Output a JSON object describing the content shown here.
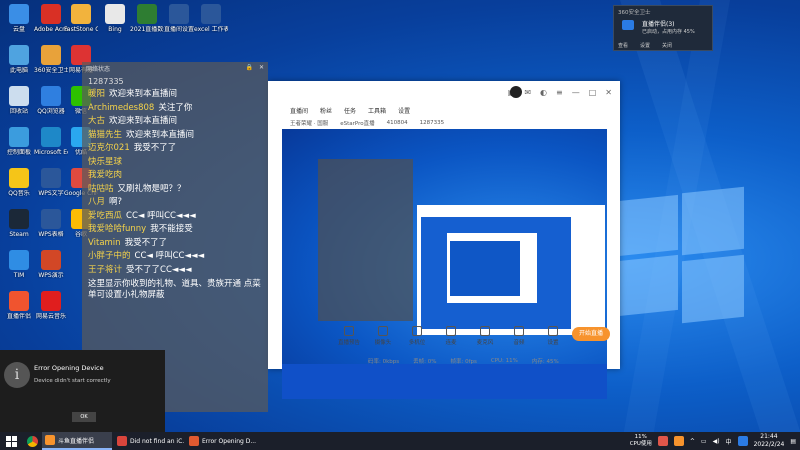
{
  "desktop": {
    "icons": [
      {
        "label": "云盘",
        "color": "#3a8ee6"
      },
      {
        "label": "Adobe AcrobatReader DC",
        "color": "#d93025"
      },
      {
        "label": "FastStone Capture",
        "color": "#f2b33d"
      },
      {
        "label": "Bing",
        "color": "#e8e8e8"
      },
      {
        "label": "2021直播数据",
        "color": "#2e7d32"
      },
      {
        "label": "直播间设置",
        "color": "#2b579a"
      },
      {
        "label": "excel 工作表数据",
        "color": "#2b579a"
      },
      {
        "label": "此电脑",
        "color": "#4fa3e0"
      },
      {
        "label": "360安全卫士",
        "color": "#e8a23a"
      },
      {
        "label": "网易有道",
        "color": "#d33"
      },
      {
        "label": "回收站",
        "color": "#cde"
      },
      {
        "label": "QQ浏览器",
        "color": "#2f7fe0"
      },
      {
        "label": "微信",
        "color": "#2dc100"
      },
      {
        "label": "控制面板",
        "color": "#3b9cde"
      },
      {
        "label": "Microsoft Edge",
        "color": "#1e88c8"
      },
      {
        "label": "优酷",
        "color": "#2aa7f0"
      },
      {
        "label": "QQ音乐",
        "color": "#f5c518"
      },
      {
        "label": "WPS文字",
        "color": "#2b579a"
      },
      {
        "label": "Google Chrome",
        "color": "#e04a3f"
      },
      {
        "label": "Steam",
        "color": "#1b2838"
      },
      {
        "label": "WPS表格",
        "color": "#2b579a"
      },
      {
        "label": "谷歌",
        "color": "#fbbc05"
      },
      {
        "label": "TIM",
        "color": "#2f8de4"
      },
      {
        "label": "WPS演示",
        "color": "#d24726"
      },
      {
        "label": "直播伴侣",
        "color": "#f0542f"
      },
      {
        "label": "网易云音乐",
        "color": "#e01e1e"
      }
    ]
  },
  "chat_overlay": {
    "header_label": "网络状态",
    "room_number": "1287335",
    "top_count": "41080",
    "messages": [
      {
        "user": "暖阳",
        "text": "欢迎来到本直播间"
      },
      {
        "user": "Archimedes808",
        "text": "关注了你"
      },
      {
        "user": "大古",
        "text": "欢迎来到本直播间"
      },
      {
        "user": "猫猫先生",
        "text": "欢迎来到本直播间"
      },
      {
        "user": "迈克尔021",
        "text": "我受不了了"
      },
      {
        "user": "快乐星球",
        "text": ""
      },
      {
        "user": "我爱吃肉",
        "text": ""
      },
      {
        "user": "咕咕咕",
        "text": "又刷礼物是吧？？"
      },
      {
        "user": "八月",
        "text": "啊?"
      },
      {
        "user": "爱吃西瓜",
        "text": "CC◄ 呼叫CC◄◄◄"
      },
      {
        "user": "我爱哈哈funny",
        "text": "我不能接受"
      },
      {
        "user": "Vitamin",
        "text": "我受不了了"
      },
      {
        "user": "小胖子中的",
        "text": "CC◄ 呼叫CC◄◄◄"
      },
      {
        "user": "王子将计",
        "text": "受不了了CC◄◄◄"
      }
    ],
    "notice": "这里显示你收到的礼物、道具、贵族开通 点菜单可设置小礼物屏蔽"
  },
  "live_app": {
    "nav_items": [
      "直播间",
      "粉丝",
      "任务",
      "工具箱",
      "设置"
    ],
    "sub_items": [
      "王者荣耀 · 国服",
      "eStarPro直播",
      "410804",
      "1287335"
    ],
    "tools": [
      "直播预告",
      "摄像头",
      "多机位",
      "连麦",
      "麦克风",
      "音频",
      "设置"
    ],
    "start_button": "开始直播",
    "status": [
      "码率: 0kbps",
      "丢帧: 0%",
      "帧率: 0fps",
      "CPU: 11%",
      "内存: 45%"
    ]
  },
  "notification": {
    "title": "360安全卫士",
    "line1": "直播伴侣(3)",
    "line2": "已启动，占用内存 45%",
    "actions": [
      "查看",
      "设置",
      "关闭"
    ]
  },
  "error_dialog": {
    "title": "Error Opening Device",
    "message": "Device didn't start correctly",
    "button": "OK"
  },
  "taskbar": {
    "apps": [
      {
        "label": "斗鱼直播伴侣",
        "color": "#f7932d",
        "active": true
      },
      {
        "label": "Did not find an iC...",
        "color": "#d9453c",
        "active": false
      },
      {
        "label": "Error Opening D...",
        "color": "#e05a30",
        "active": false
      }
    ],
    "cpu_percent": "11%",
    "cpu_label": "CPU使用",
    "ime": "中",
    "time": "21:44",
    "date": "2022/2/24"
  }
}
